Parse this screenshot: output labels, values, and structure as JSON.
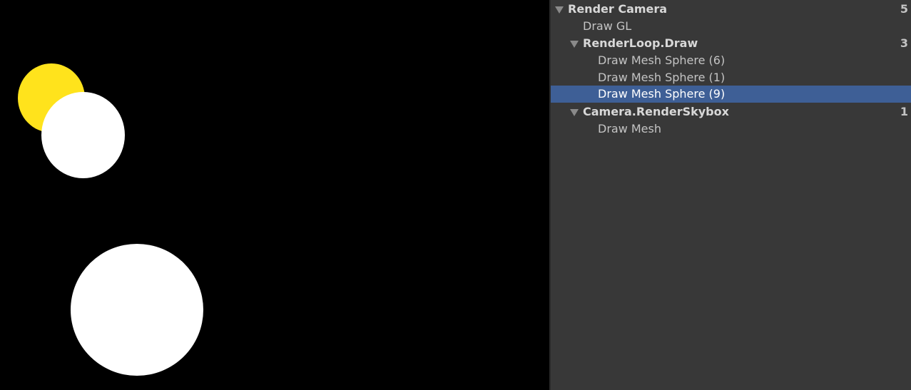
{
  "viewport": {
    "spheres": [
      {
        "name": "yellow-sphere",
        "color": "#FFE31C"
      },
      {
        "name": "white-sphere-1",
        "color": "#FFFFFF"
      },
      {
        "name": "white-sphere-2",
        "color": "#FFFFFF"
      }
    ]
  },
  "tree": {
    "rows": [
      {
        "label": "Render Camera",
        "count": "5"
      },
      {
        "label": "Draw GL",
        "count": ""
      },
      {
        "label": "RenderLoop.Draw",
        "count": "3"
      },
      {
        "label": "Draw Mesh Sphere (6)",
        "count": ""
      },
      {
        "label": "Draw Mesh Sphere (1)",
        "count": ""
      },
      {
        "label": "Draw Mesh Sphere (9)",
        "count": ""
      },
      {
        "label": "Camera.RenderSkybox",
        "count": "1"
      },
      {
        "label": "Draw Mesh",
        "count": ""
      }
    ],
    "selection_color": "#3E5F96"
  }
}
